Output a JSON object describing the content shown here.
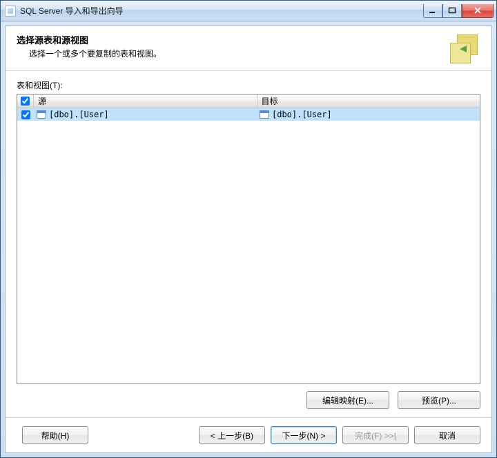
{
  "window": {
    "title": "SQL Server 导入和导出向导"
  },
  "header": {
    "title": "选择源表和源视图",
    "subtitle": "选择一个或多个要复制的表和视图。"
  },
  "list_label": "表和视图(T):",
  "columns": {
    "source": "源",
    "target": "目标"
  },
  "rows": [
    {
      "checked": true,
      "source": "[dbo].[User]",
      "target": "[dbo].[User]"
    }
  ],
  "buttons": {
    "edit_mapping": "编辑映射(E)...",
    "preview": "预览(P)...",
    "help": "帮助(H)",
    "back": "< 上一步(B)",
    "next_label": "下一步(N) >",
    "finish": "完成(F) >>|",
    "cancel": "取消"
  }
}
